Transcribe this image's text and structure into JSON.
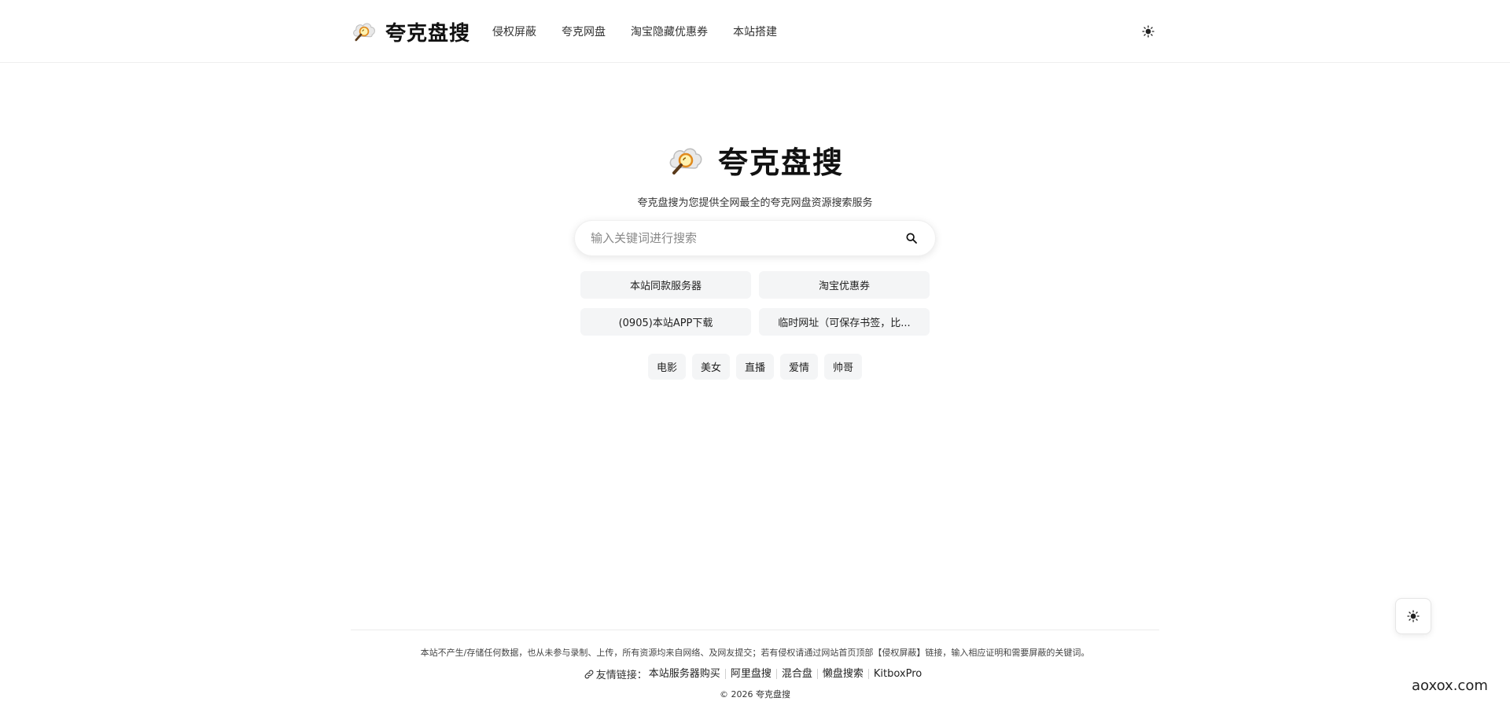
{
  "header": {
    "site_name": "夸克盘搜",
    "nav": [
      {
        "label": "侵权屏蔽"
      },
      {
        "label": "夸克网盘"
      },
      {
        "label": "淘宝隐藏优惠券"
      },
      {
        "label": "本站搭建"
      }
    ]
  },
  "hero": {
    "title": "夸克盘搜",
    "subtitle": "夸克盘搜为您提供全网最全的夸克网盘资源搜索服务"
  },
  "search": {
    "placeholder": "输入关键词进行搜索",
    "value": ""
  },
  "quick_links": [
    {
      "label": "本站同款服务器"
    },
    {
      "label": "淘宝优惠券"
    },
    {
      "label": "(0905)本站APP下载"
    },
    {
      "label": "临时网址（可保存书签，比..."
    }
  ],
  "tags": [
    {
      "label": "电影"
    },
    {
      "label": "美女"
    },
    {
      "label": "直播"
    },
    {
      "label": "爱情"
    },
    {
      "label": "帅哥"
    }
  ],
  "footer": {
    "disclaimer": "本站不产生/存储任何数据，也从未参与录制、上传，所有资源均来自网络、及网友提交；若有侵权请通过网站首页顶部【侵权屏蔽】链接，输入相应证明和需要屏蔽的关键词。",
    "friend_links_label": "友情链接：",
    "friend_links": [
      {
        "label": "本站服务器购买"
      },
      {
        "label": "阿里盘搜"
      },
      {
        "label": "混合盘"
      },
      {
        "label": "懒盘搜索"
      },
      {
        "label": "KitboxPro"
      }
    ],
    "copyright": "© 2026 夸克盘搜"
  },
  "watermark": "aoxox.com",
  "icons": {
    "logo": "cloud-magnifier-icon",
    "search": "search-icon",
    "theme": "sun-icon",
    "link": "link-icon"
  },
  "colors": {
    "background": "#ffffff",
    "chip_background": "#f4f5f6",
    "text_primary": "#111111",
    "divider": "#eeeeee"
  }
}
